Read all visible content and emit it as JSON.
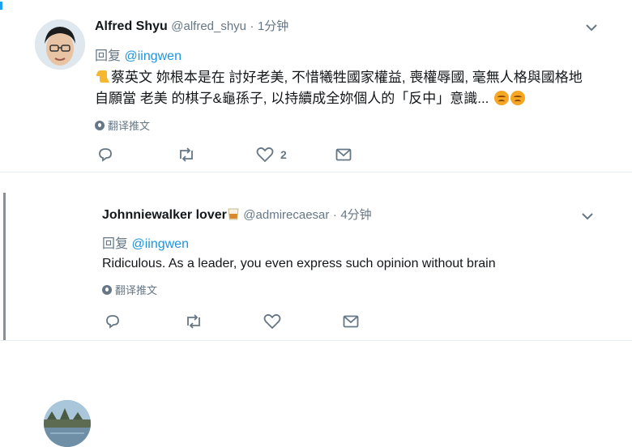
{
  "tweets": [
    {
      "name": "Alfred Shyu",
      "handle": "@alfred_shyu",
      "separator": "·",
      "time": "1分钟",
      "reply_prefix": "回复",
      "reply_mention": "@iingwen",
      "text_line1": "蔡英文 妳根本是在 討好老美, 不惜犧牲國家權益, 喪權辱國, 毫無人格與國格地",
      "text_line2": "自願當 老美 的棋子&龜孫子, 以持續成全妳個人的「反中」意識...",
      "translate_label": "翻译推文",
      "like_count": "2",
      "leading_emoji": "thumbs-down",
      "trailing_emoji": [
        "confounded-face",
        "confounded-face"
      ]
    },
    {
      "name": "Johnniewalker lover",
      "name_emoji": "whisky-glass",
      "handle": "@admirecaesar",
      "separator": "·",
      "time": "4分钟",
      "reply_prefix": "回复",
      "reply_mention": "@iingwen",
      "text": "Ridiculous. As a leader, you even express such opinion without brain",
      "translate_label": "翻译推文",
      "like_count": ""
    }
  ],
  "colors": {
    "link": "#1b95e0",
    "muted": "#657786",
    "text": "#14171a",
    "divider": "#e6ecf0"
  },
  "icons": [
    "chevron-down-icon",
    "reply-icon",
    "retweet-icon",
    "like-icon",
    "message-icon",
    "globe-icon"
  ]
}
